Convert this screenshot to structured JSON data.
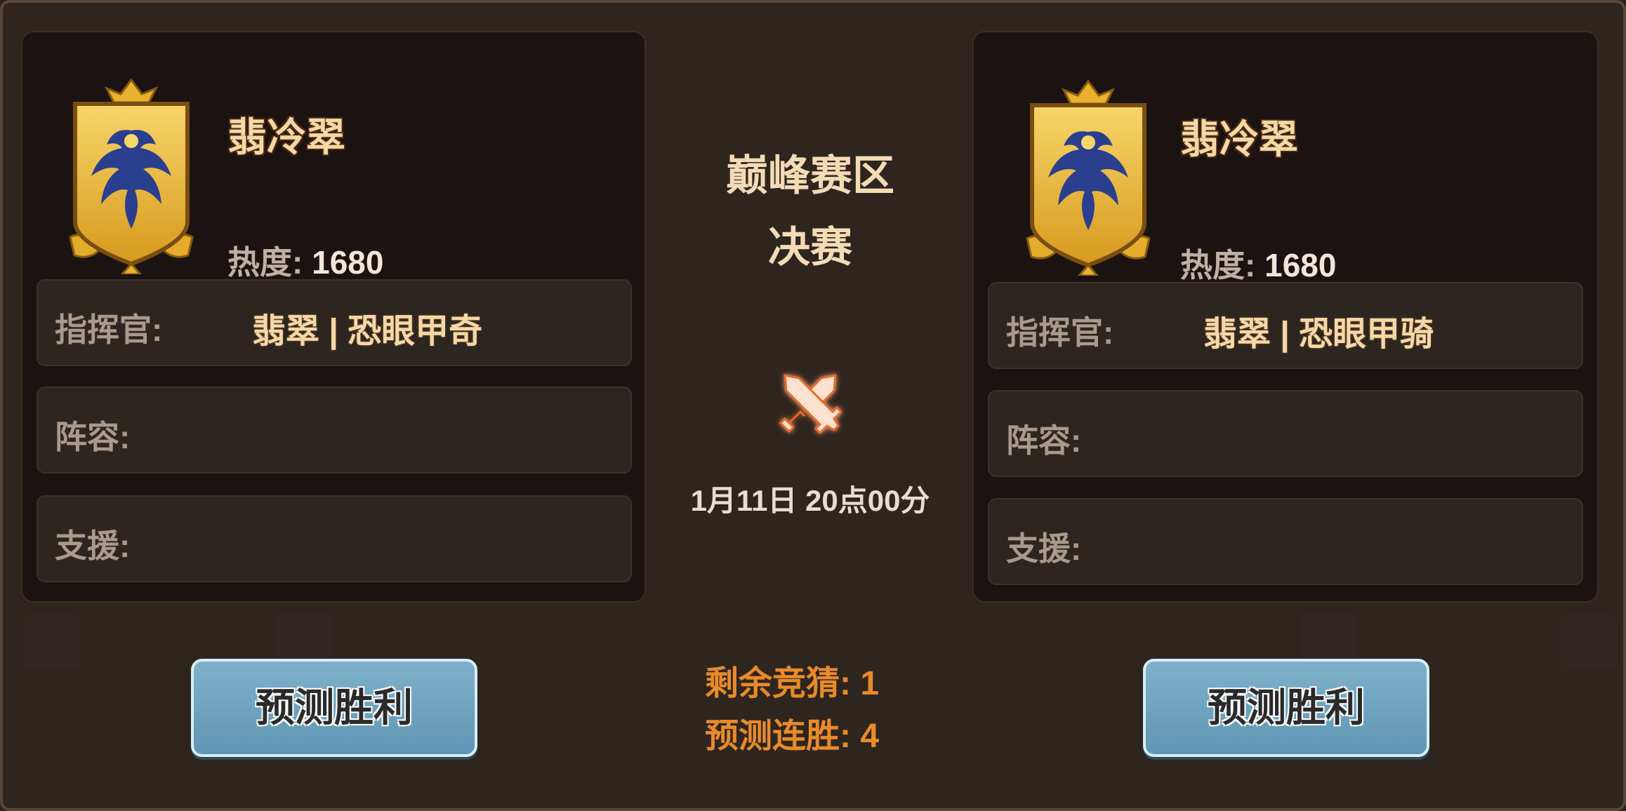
{
  "match": {
    "region": "巅峰赛区",
    "stage": "决赛",
    "datetime": "1月11日 20点00分"
  },
  "left_team": {
    "emblem_icon": "phoenix-shield-emblem",
    "name": "翡冷翠",
    "heat_label": "热度:",
    "heat_value": "1680",
    "commander_label": "指挥官:",
    "commander_value": "翡翠 | 恐眼甲奇",
    "lineup_label": "阵容:",
    "lineup_value": "",
    "support_label": "支援:",
    "support_value": "",
    "predict_label": "预测胜利"
  },
  "right_team": {
    "emblem_icon": "phoenix-shield-emblem",
    "name": "翡冷翠",
    "heat_label": "热度:",
    "heat_value": "1680",
    "commander_label": "指挥官:",
    "commander_value": "翡翠 | 恐眼甲骑",
    "lineup_label": "阵容:",
    "lineup_value": "",
    "support_label": "支援:",
    "support_value": "",
    "predict_label": "预测胜利"
  },
  "stats": {
    "remaining_label": "剩余竞猜:",
    "remaining_value": "1",
    "streak_label": "预测连胜:",
    "streak_value": "4"
  },
  "colors": {
    "accent_orange": "#e98a2a",
    "button_blue": "#6fa6c2",
    "gold": "#e0a92a",
    "emblem_blue": "#2b3f8f"
  }
}
